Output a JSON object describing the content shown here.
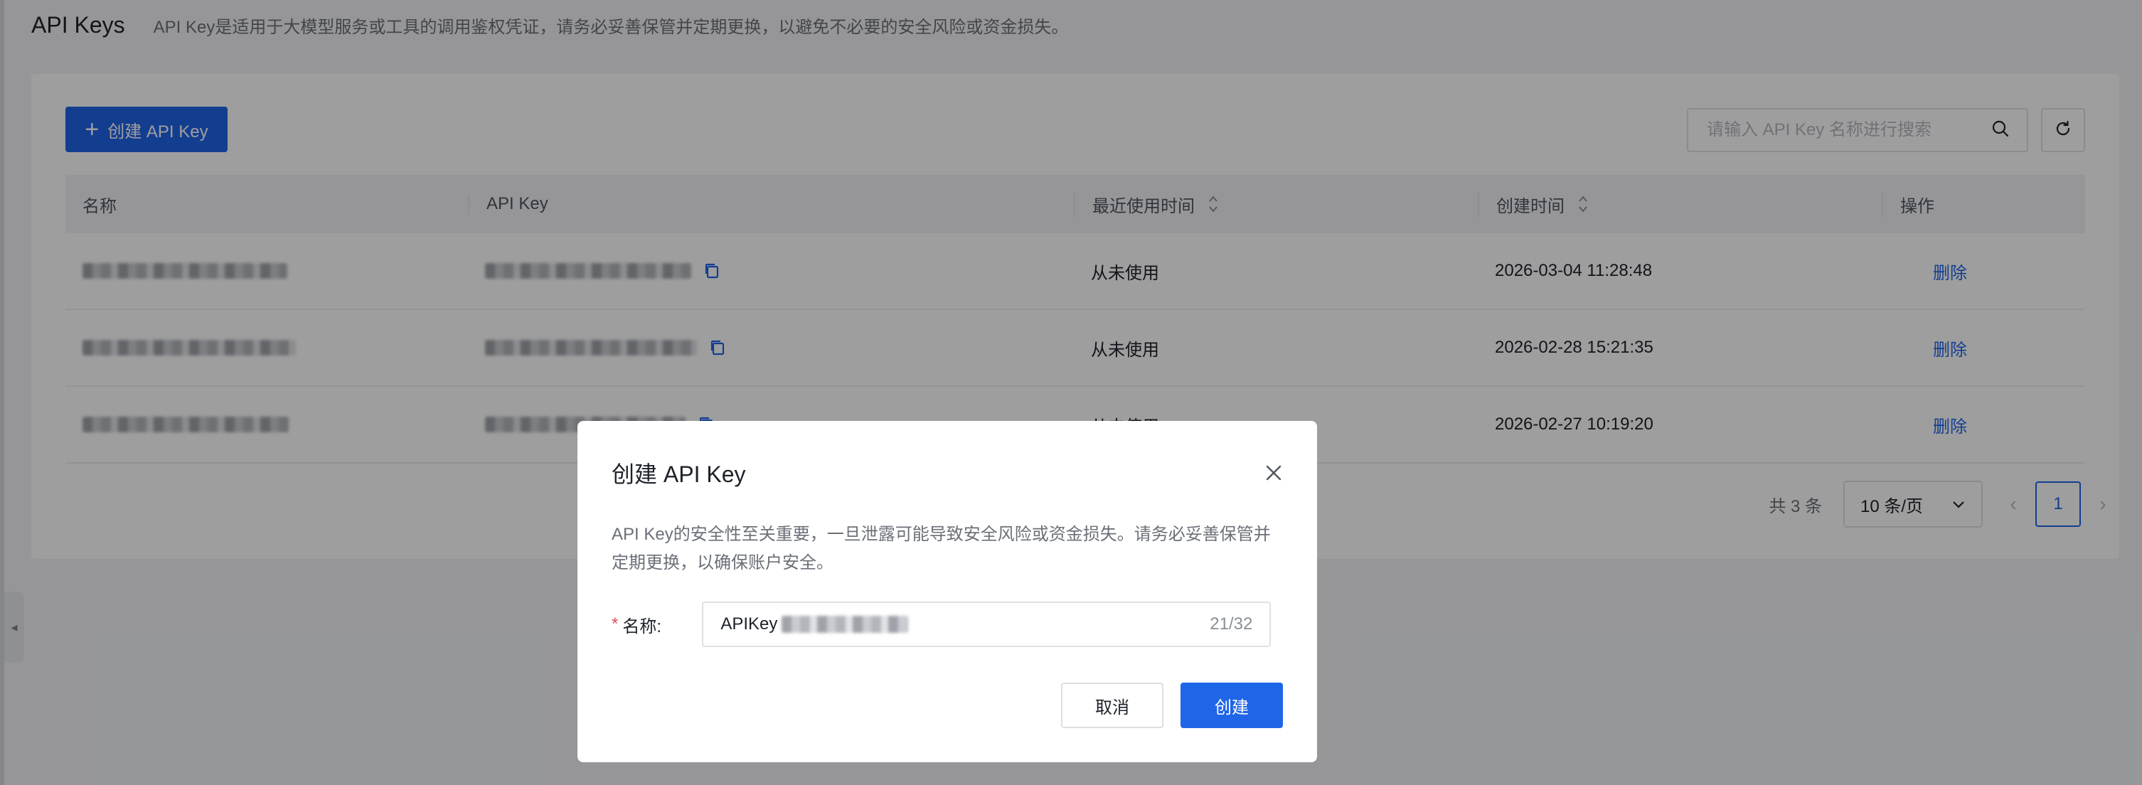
{
  "header": {
    "title": "API Keys",
    "description": "API Key是适用于大模型服务或工具的调用鉴权凭证，请务必妥善保管并定期更换，以避免不必要的安全风险或资金损失。"
  },
  "toolbar": {
    "create_label": "创建 API Key",
    "search_placeholder": "请输入 API Key 名称进行搜索"
  },
  "table": {
    "columns": [
      "名称",
      "API Key",
      "最近使用时间",
      "创建时间",
      "操作"
    ],
    "rows": [
      {
        "last_used": "从未使用",
        "created": "2026-03-04 11:28:48",
        "action": "删除"
      },
      {
        "last_used": "从未使用",
        "created": "2026-02-28 15:21:35",
        "action": "删除"
      },
      {
        "last_used": "从未使用",
        "created": "2026-02-27 10:19:20",
        "action": "删除"
      }
    ]
  },
  "pagination": {
    "total": "共 3 条",
    "page_size": "10 条/页",
    "current_page": "1"
  },
  "modal": {
    "title": "创建 API Key",
    "description": "API Key的安全性至关重要，一旦泄露可能导致安全风险或资金损失。请务必妥善保管并定期更换，以确保账户安全。",
    "required_mark": "*",
    "name_label": "名称:",
    "name_value_prefix": "APIKey",
    "char_count": "21/32",
    "cancel_label": "取消",
    "confirm_label": "创建"
  },
  "colors": {
    "primary": "#1f65e8",
    "danger": "#e34d59"
  }
}
